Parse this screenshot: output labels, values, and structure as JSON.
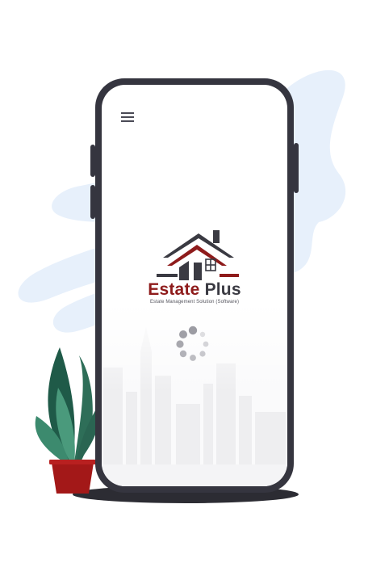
{
  "app": {
    "brand_word_1": "Estate",
    "brand_word_2": "Plus",
    "tagline": "Estate Management Solution (Software)"
  },
  "colors": {
    "brand_red": "#8e1b1b",
    "brand_dark": "#3a3a42",
    "phone_frame": "#35353f",
    "blob_blue": "#e7f0fb",
    "plant_green": "#2e6e58",
    "pot_red": "#a31818"
  },
  "icons": {
    "menu": "hamburger-menu-icon",
    "logo": "house-logo-icon",
    "loading": "loading-spinner-icon"
  }
}
